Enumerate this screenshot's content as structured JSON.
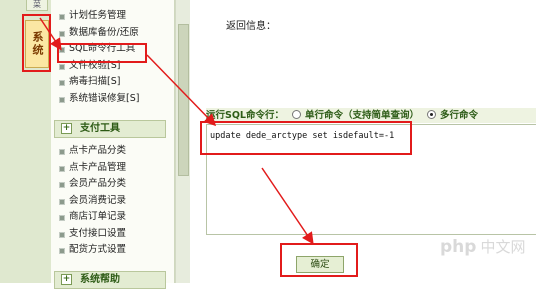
{
  "tabs": {
    "prev_label": "菜",
    "active_label": "系统"
  },
  "menu": {
    "group1": [
      "计划任务管理",
      "数据库备份/还原",
      "SQL命令行工具",
      "文件校验[S]",
      "病毒扫描[S]",
      "系统错误修复[S]"
    ],
    "section2_title": "支付工具",
    "group2": [
      "点卡产品分类",
      "点卡产品管理",
      "会员产品分类",
      "会员消费记录",
      "商店订单记录",
      "支付接口设置",
      "配货方式设置"
    ],
    "section3_title": "系统帮助"
  },
  "main": {
    "return_label": "返回信息：",
    "sql_row": {
      "label": "运行SQL命令行：",
      "option_single": "单行命令（支持简单查询）",
      "option_multi": "多行命令",
      "selected": "多行命令"
    },
    "sql_text": "update dede_arctype set isdefault=-1",
    "ok_label": "确定"
  },
  "watermark": {
    "logo": "php",
    "site": "中文网"
  },
  "colors": {
    "annotation": "#e21b1b",
    "section_text": "#2d5c17",
    "panel_bg": "#dfe8cf"
  }
}
